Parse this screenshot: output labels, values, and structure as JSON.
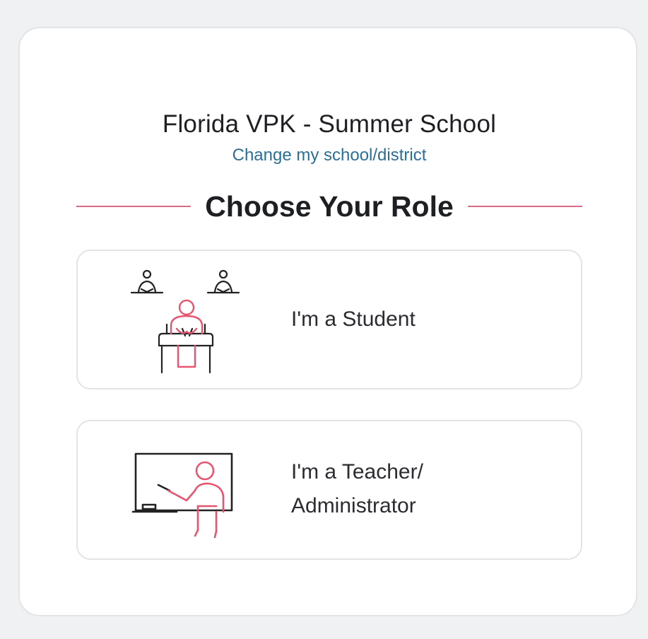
{
  "header": {
    "school_name": "Florida VPK - Summer School",
    "change_link": "Change my school/district"
  },
  "role_section": {
    "heading": "Choose Your Role"
  },
  "roles": [
    {
      "label": "I'm a Student",
      "icon": "student-desk-icon"
    },
    {
      "label": "I'm a Teacher/ Administrator",
      "icon": "teacher-whiteboard-icon"
    }
  ],
  "colors": {
    "background": "#f0f1f3",
    "card": "#ffffff",
    "border": "#e2e4e7",
    "accent": "#d96a85",
    "link": "#2c6f95",
    "text": "#1d1f22"
  }
}
